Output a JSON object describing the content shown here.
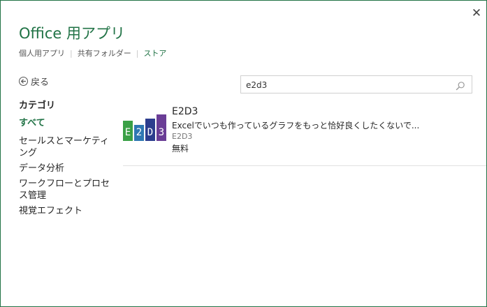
{
  "window": {
    "close_label": "✕"
  },
  "header": {
    "title": "Office 用アプリ"
  },
  "nav": {
    "links": [
      {
        "label": "個人用アプリ"
      },
      {
        "label": "共有フォルダー"
      },
      {
        "label": "ストア",
        "active": true
      }
    ],
    "separator": "|"
  },
  "back": {
    "label": "戻る",
    "icon": "back-arrow-icon"
  },
  "sidebar": {
    "heading": "カテゴリ",
    "items": [
      {
        "label": "すべて",
        "active": true
      },
      {
        "label": "セールスとマーケティング"
      },
      {
        "label": "データ分析"
      },
      {
        "label": "ワークフローとプロセス管理"
      },
      {
        "label": "視覚エフェクト"
      }
    ]
  },
  "search": {
    "value": "e2d3",
    "icon": "search-icon"
  },
  "results": [
    {
      "name": "E2D3",
      "description": "Excelでいつも作っているグラフをもっと恰好良くしたくないで...",
      "publisher": "E2D3",
      "price": "無料",
      "logo_text": [
        "E",
        "2",
        "D",
        "3"
      ]
    }
  ],
  "colors": {
    "accent": "#217346",
    "logo_e": "#3aa046",
    "logo_2": "#2f78b3",
    "logo_d": "#2c3d8e",
    "logo_3": "#6a3d96"
  }
}
